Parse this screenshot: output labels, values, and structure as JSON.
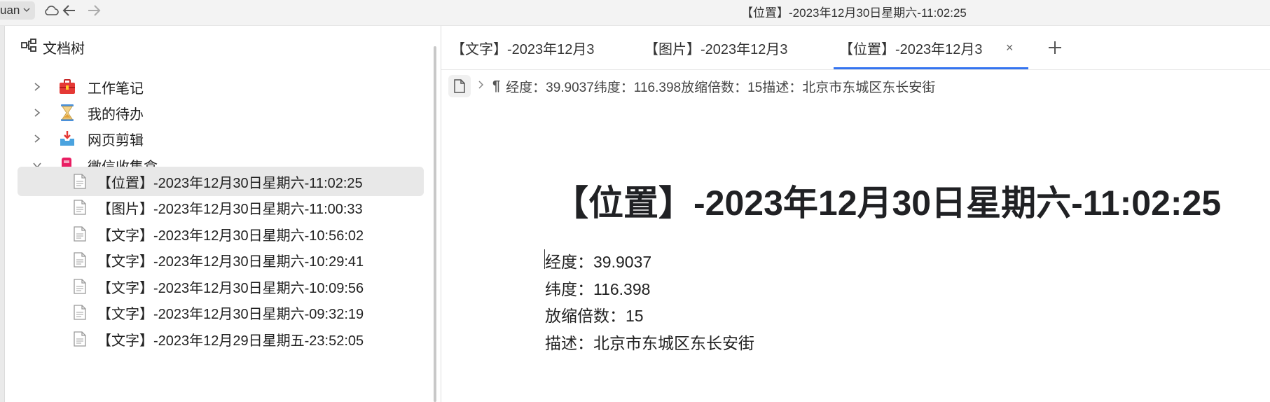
{
  "topbar": {
    "user_label": "uan",
    "window_title": "【位置】-2023年12月30日星期六-11:02:25",
    "icons": [
      "cloud-icon",
      "back-arrow-icon",
      "forward-arrow-icon"
    ]
  },
  "sidebar": {
    "header": "文档树",
    "notebooks": [
      {
        "label": "工作笔记",
        "icon": "toolbox-icon",
        "expanded": false
      },
      {
        "label": "我的待办",
        "icon": "hourglass-icon",
        "expanded": false
      },
      {
        "label": "网页剪辑",
        "icon": "inbox-tray-icon",
        "expanded": false
      },
      {
        "label": "微信收集盒",
        "icon": "mailbox-icon",
        "expanded": true
      }
    ],
    "documents": [
      {
        "label": "【位置】-2023年12月30日星期六-11:02:25",
        "selected": true
      },
      {
        "label": "【图片】-2023年12月30日星期六-11:00:33",
        "selected": false
      },
      {
        "label": "【文字】-2023年12月30日星期六-10:56:02",
        "selected": false
      },
      {
        "label": "【文字】-2023年12月30日星期六-10:29:41",
        "selected": false
      },
      {
        "label": "【文字】-2023年12月30日星期六-10:09:56",
        "selected": false
      },
      {
        "label": "【文字】-2023年12月30日星期六-09:32:19",
        "selected": false
      },
      {
        "label": "【文字】-2023年12月29日星期五-23:52:05",
        "selected": false
      }
    ]
  },
  "tabs": [
    {
      "label": "【文字】-2023年12月3",
      "active": false
    },
    {
      "label": "【图片】-2023年12月3",
      "active": false
    },
    {
      "label": "【位置】-2023年12月3",
      "active": true,
      "close": "×"
    }
  ],
  "breadcrumb": {
    "pilcrow": "¶",
    "text": "经度：39.9037纬度：116.398放缩倍数：15描述：北京市东城区东长安街"
  },
  "document": {
    "title": "【位置】-2023年12月30日星期六-11:02:25",
    "paragraphs": [
      "经度：39.9037",
      "纬度：116.398",
      "放缩倍数：15",
      "描述：北京市东城区东长安街"
    ]
  },
  "colors": {
    "accent": "#3574f0",
    "selected_row": "#e8e8e8",
    "topbar_bg": "#f3f3f3"
  }
}
